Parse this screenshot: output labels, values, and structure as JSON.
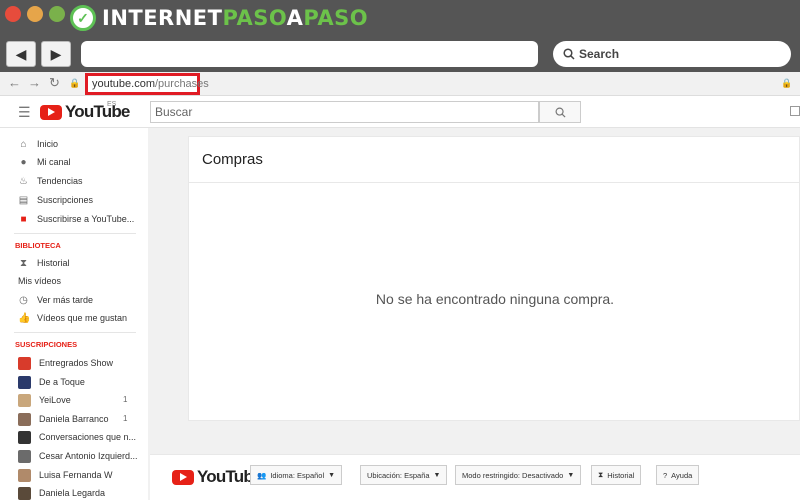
{
  "window": {
    "brand": {
      "part1": "INTERNET",
      "part2": "PASO",
      "part3": "A",
      "part4": "PASO"
    },
    "toolbar": {
      "search_label": "Search"
    }
  },
  "browser": {
    "url_host": "youtube.com",
    "url_path": "/purchases"
  },
  "header": {
    "logo_text": "YouTube",
    "country": "ES",
    "search_placeholder": "Buscar"
  },
  "sidebar": {
    "main_items": [
      {
        "label": "Inicio",
        "icon": "home-icon"
      },
      {
        "label": "Mi canal",
        "icon": "account-icon"
      },
      {
        "label": "Tendencias",
        "icon": "flame-icon"
      },
      {
        "label": "Suscripciones",
        "icon": "subscriptions-icon"
      },
      {
        "label": "Suscribirse a YouTube...",
        "icon": "youtube-red-icon"
      }
    ],
    "library_title": "BIBLIOTECA",
    "library_items": [
      {
        "label": "Historial",
        "icon": "hourglass-icon"
      },
      {
        "label": "Mis vídeos",
        "icon": ""
      },
      {
        "label": "Ver más tarde",
        "icon": "clock-icon"
      },
      {
        "label": "Vídeos que me gustan",
        "icon": "thumb-up-icon"
      }
    ],
    "subs_title": "SUSCRIPCIONES",
    "subs": [
      {
        "label": "Entregrados Show",
        "count": "",
        "color": "#d83b2b"
      },
      {
        "label": "De a Toque",
        "count": "",
        "color": "#2b3a6b"
      },
      {
        "label": "YeiLove",
        "count": "1",
        "color": "#c9a77c"
      },
      {
        "label": "Daniela Barranco",
        "count": "1",
        "color": "#8a6d5a"
      },
      {
        "label": "Conversaciones que n...",
        "count": "",
        "color": "#333333"
      },
      {
        "label": "Cesar Antonio Izquierd...",
        "count": "",
        "color": "#6b6b6b"
      },
      {
        "label": "Luisa Fernanda W",
        "count": "",
        "color": "#b08a6a"
      },
      {
        "label": "Daniela Legarda",
        "count": "",
        "color": "#5a4a3a"
      }
    ]
  },
  "main": {
    "title": "Compras",
    "empty_message": "No se ha encontrado ninguna compra."
  },
  "footer": {
    "logo_text": "YouTube",
    "language": "Idioma: Español",
    "location": "Ubicación: España",
    "restricted": "Modo restringido: Desactivado",
    "history": "Historial",
    "help": "Ayuda"
  }
}
